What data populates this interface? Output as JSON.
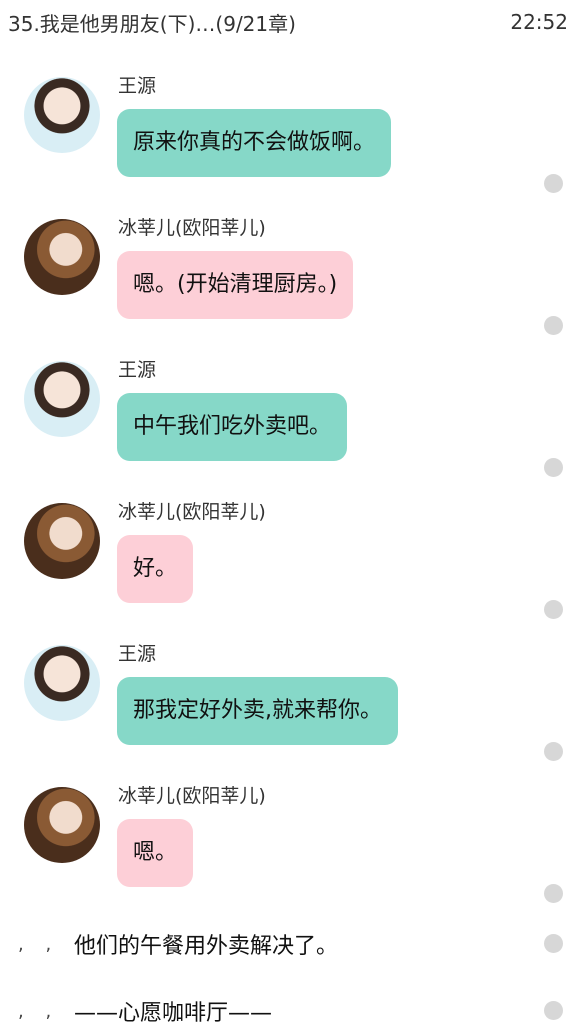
{
  "status_bar": {
    "chapter_title": "35.我是他男朋友(下)…(9/21章)",
    "time": "22:52"
  },
  "messages": [
    {
      "sender": "王源",
      "text": "原来你真的不会做饭啊。",
      "bubble_color": "#86d8c8"
    },
    {
      "sender": "冰莘儿(欧阳莘儿)",
      "text": "嗯。(开始清理厨房。)",
      "bubble_color": "#fdcfd7"
    },
    {
      "sender": "王源",
      "text": "中午我们吃外卖吧。",
      "bubble_color": "#86d8c8"
    },
    {
      "sender": "冰莘儿(欧阳莘儿)",
      "text": "好。",
      "bubble_color": "#fdcfd7"
    },
    {
      "sender": "王源",
      "text": "那我定好外卖,就来帮你。",
      "bubble_color": "#86d8c8"
    },
    {
      "sender": "冰莘儿(欧阳莘儿)",
      "text": "嗯。",
      "bubble_color": "#fdcfd7"
    }
  ],
  "narration": [
    {
      "marks": ", ,",
      "text": "他们的午餐用外卖解决了。"
    },
    {
      "marks": ", ,",
      "text": "——心愿咖啡厅——"
    }
  ]
}
